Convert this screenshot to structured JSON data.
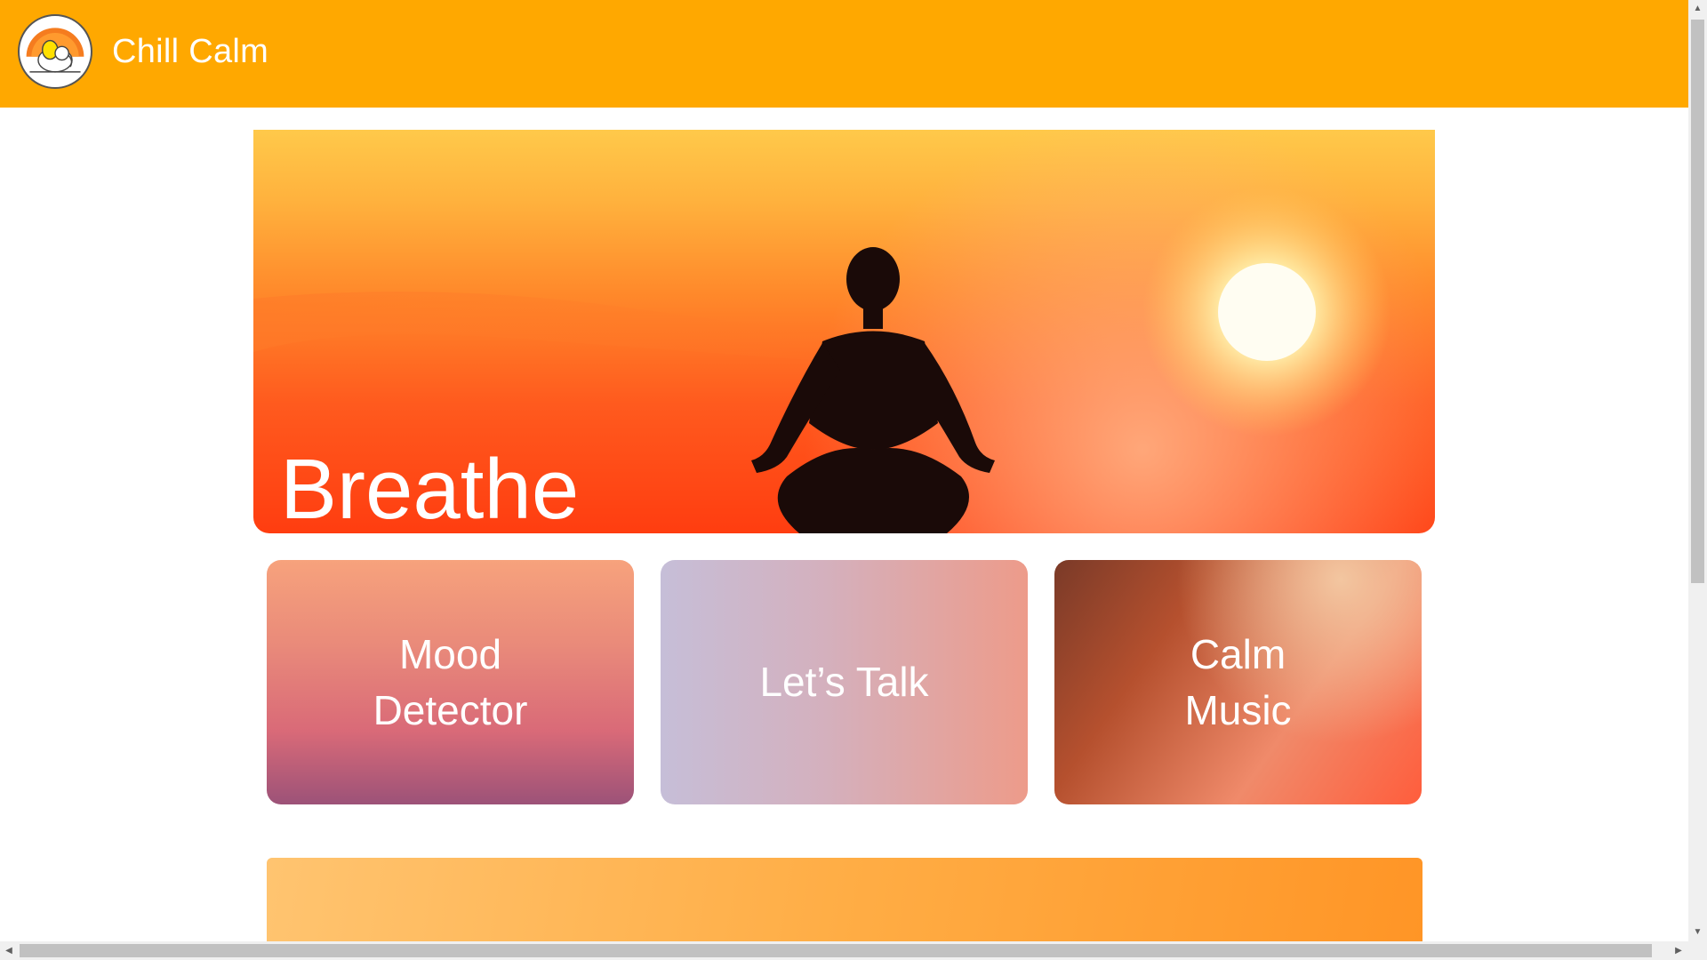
{
  "header": {
    "app_title": "Chill Calm",
    "logo_icon": "elephant-sun-icon",
    "background_color": "#ffa800"
  },
  "hero": {
    "title": "Breathe",
    "image": "meditation-silhouette-sunset"
  },
  "cards": [
    {
      "label": "Mood\nDetector"
    },
    {
      "label": "Let’s Talk"
    },
    {
      "label": "Calm\nMusic"
    }
  ],
  "scrollbars": {
    "up_arrow": "▲",
    "down_arrow": "▼",
    "left_arrow": "◀",
    "right_arrow": "▶"
  }
}
